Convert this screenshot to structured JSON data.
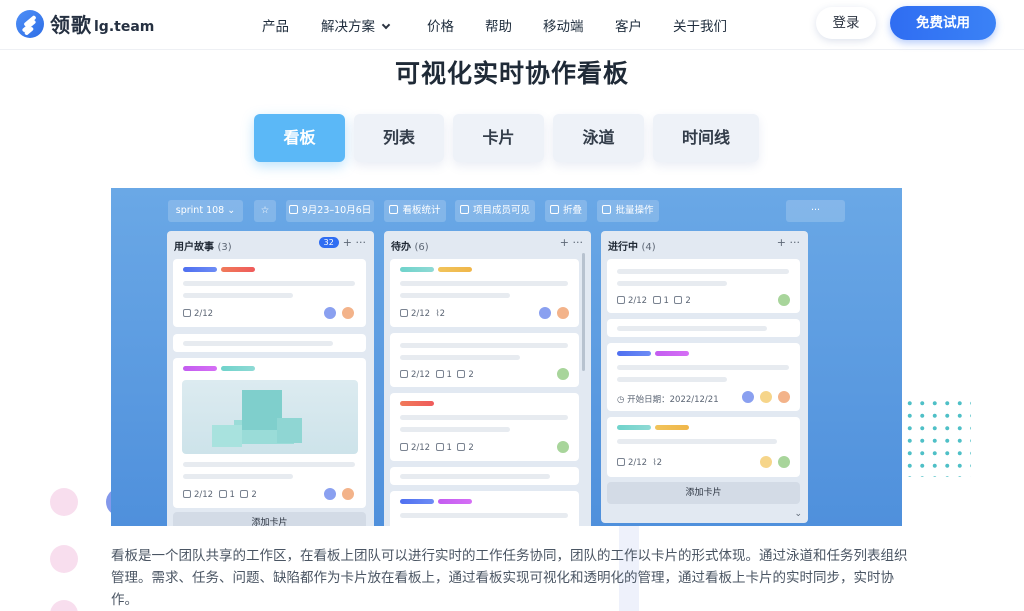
{
  "logo": {
    "name": "领歌",
    "sub": "lg.team"
  },
  "nav": {
    "items": [
      "产品",
      "解决方案",
      "价格",
      "帮助",
      "移动端",
      "客户",
      "关于我们"
    ],
    "login": "登录",
    "try": "免费试用"
  },
  "title": "可视化实时协作看板",
  "tabs": [
    "看板",
    "列表",
    "卡片",
    "泳道",
    "时间线"
  ],
  "board": {
    "toolbar": {
      "sprint": "sprint 108",
      "dates": "9月23–10月6日",
      "stats": "看板统计",
      "members": "项目成员可见",
      "fold": "折叠",
      "batch": "批量操作",
      "more": "···"
    },
    "columns": [
      {
        "name": "用户故事",
        "count": "(3)",
        "badge": "32",
        "tools": "+ ···"
      },
      {
        "name": "待办",
        "count": "(6)",
        "tools": "+ ···"
      },
      {
        "name": "进行中",
        "count": "(4)",
        "tools": "+ ···"
      }
    ],
    "meta": {
      "tasks": "2/12",
      "comments": "1",
      "subs": "2",
      "attach": "2",
      "start_date": "开始日期：2022/12/21"
    },
    "add_card": "添加卡片"
  },
  "description": "看板是一个团队共享的工作区，在看板上团队可以进行实时的工作任务协同，团队的工作以卡片的形式体现。通过泳道和任务列表组织管理。需求、任务、问题、缺陷都作为卡片放在看板上，通过看板实现可视化和透明化的管理，通过看板上卡片的实时同步，实时协作。",
  "colors": {
    "accent": "#2f6df2",
    "tab_active": "#5bb8f7",
    "board_bg": "#5a9ae0"
  }
}
